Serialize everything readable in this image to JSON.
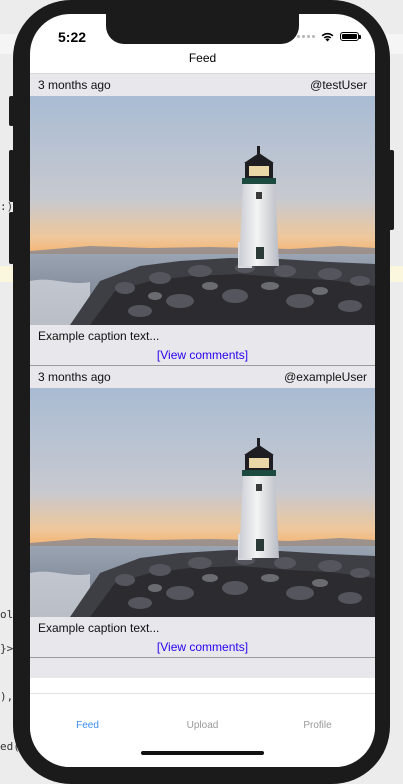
{
  "status": {
    "time": "5:22"
  },
  "nav": {
    "title": "Feed"
  },
  "posts": [
    {
      "timestamp": "3 months ago",
      "user": "@testUser",
      "caption": "Example caption text...",
      "comments_link": "[View comments]"
    },
    {
      "timestamp": "3 months ago",
      "user": "@exampleUser",
      "caption": "Example caption text...",
      "comments_link": "[View comments]"
    }
  ],
  "tabs": [
    {
      "label": "Feed",
      "active": true
    },
    {
      "label": "Upload",
      "active": false
    },
    {
      "label": "Profile",
      "active": false
    }
  ],
  "colors": {
    "accent": "#3c8df0",
    "link": "#2b00f0",
    "post_bg": "#e7e7ec"
  }
}
